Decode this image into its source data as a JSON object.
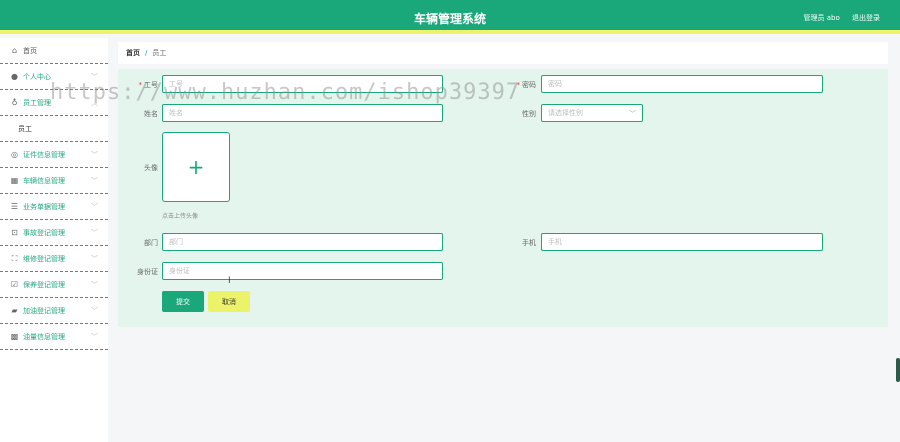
{
  "header": {
    "title": "车辆管理系统",
    "user": "管理员 abo",
    "logout": "退出登录"
  },
  "sidebar": {
    "items": [
      {
        "label": "首页",
        "icon": "home-icon"
      },
      {
        "label": "个人中心",
        "icon": "user-icon"
      },
      {
        "label": "员工管理",
        "icon": "people-icon"
      },
      {
        "label": "证件信息管理",
        "icon": "id-card-icon"
      },
      {
        "label": "车辆信息管理",
        "icon": "car-icon"
      },
      {
        "label": "业务单据管理",
        "icon": "list-icon"
      },
      {
        "label": "事故登记管理",
        "icon": "accident-icon"
      },
      {
        "label": "维修登记管理",
        "icon": "repair-icon"
      },
      {
        "label": "保养登记管理",
        "icon": "maintenance-icon"
      },
      {
        "label": "加油登记管理",
        "icon": "fuel-icon"
      },
      {
        "label": "油量信息管理",
        "icon": "oil-icon"
      }
    ],
    "subitem": "员工"
  },
  "breadcrumb": {
    "home": "首页",
    "separator": "/",
    "current": "员工"
  },
  "form": {
    "job_no": {
      "label": "工号",
      "placeholder": "工号"
    },
    "password": {
      "label": "密码",
      "placeholder": "密码"
    },
    "name": {
      "label": "姓名",
      "placeholder": "姓名"
    },
    "gender": {
      "label": "性别",
      "placeholder": "请选择性别"
    },
    "avatar": {
      "label": "头像",
      "tip": "点击上传头像"
    },
    "department": {
      "label": "部门",
      "placeholder": "部门"
    },
    "phone": {
      "label": "手机",
      "placeholder": "手机"
    },
    "id_card": {
      "label": "身份证",
      "placeholder": "身份证"
    },
    "submit": "提交",
    "cancel": "取消"
  },
  "watermark": "https://www.huzhan.com/ishop39397",
  "colors": {
    "primary": "#1aa87a",
    "accent": "#ecf36a",
    "card_bg": "#e4f5ee"
  }
}
